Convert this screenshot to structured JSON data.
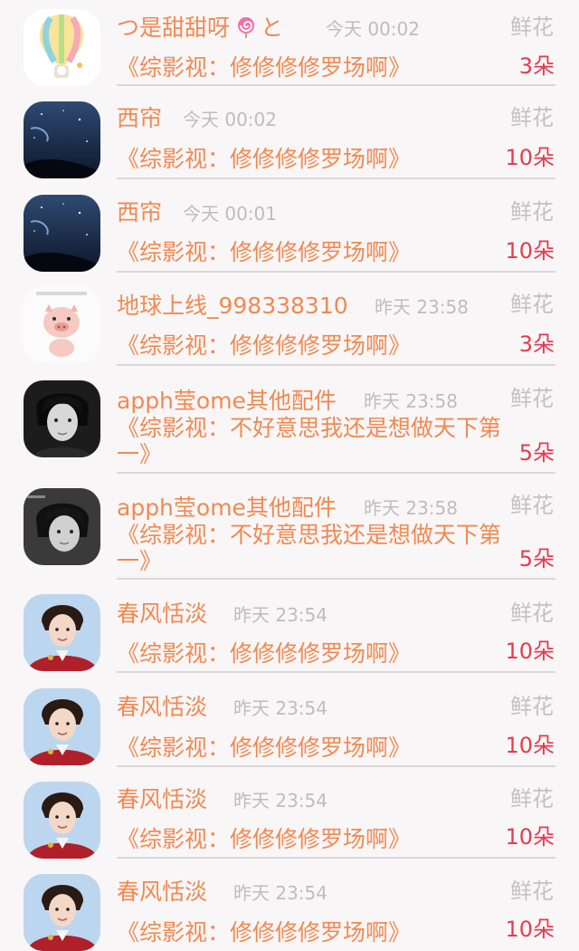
{
  "gift_label": "鲜花",
  "rows": [
    {
      "name": "つ是甜甜呀",
      "name_suffix": "と",
      "time": "今天 00:02",
      "book": "《综影视：修修修修罗场啊》",
      "count": "3朵",
      "avatar": "balloon-avatar"
    },
    {
      "name": "西帘",
      "time": "今天 00:02",
      "book": "《综影视：修修修修罗场啊》",
      "count": "10朵",
      "avatar": "night-sky-avatar"
    },
    {
      "name": "西帘",
      "time": "今天 00:01",
      "book": "《综影视：修修修修罗场啊》",
      "count": "10朵",
      "avatar": "night-sky-avatar"
    },
    {
      "name": "地球上线_998338310",
      "time": "昨天 23:58",
      "book": "《综影视：修修修修罗场啊》",
      "count": "3朵",
      "avatar": "pig-avatar"
    },
    {
      "name": "apph莹ome其他配件",
      "time": "昨天 23:58",
      "book": "《综影视：不好意思我还是想做天下第一》",
      "count": "5朵",
      "avatar": "bw-portrait-avatar"
    },
    {
      "name": "apph莹ome其他配件",
      "time": "昨天 23:58",
      "book": "《综影视：不好意思我还是想做天下第一》",
      "count": "5朵",
      "avatar": "bw-portrait-avatar"
    },
    {
      "name": "春风恬淡",
      "time": "昨天 23:54",
      "book": "《综影视：修修修修罗场啊》",
      "count": "10朵",
      "avatar": "red-jacket-avatar"
    },
    {
      "name": "春风恬淡",
      "time": "昨天 23:54",
      "book": "《综影视：修修修修罗场啊》",
      "count": "10朵",
      "avatar": "red-jacket-avatar"
    },
    {
      "name": "春风恬淡",
      "time": "昨天 23:54",
      "book": "《综影视：修修修修罗场啊》",
      "count": "10朵",
      "avatar": "red-jacket-avatar"
    },
    {
      "name": "春风恬淡",
      "time": "昨天 23:54",
      "book": "《综影视：修修修修罗场啊》",
      "count": "10朵",
      "avatar": "red-jacket-avatar"
    }
  ]
}
